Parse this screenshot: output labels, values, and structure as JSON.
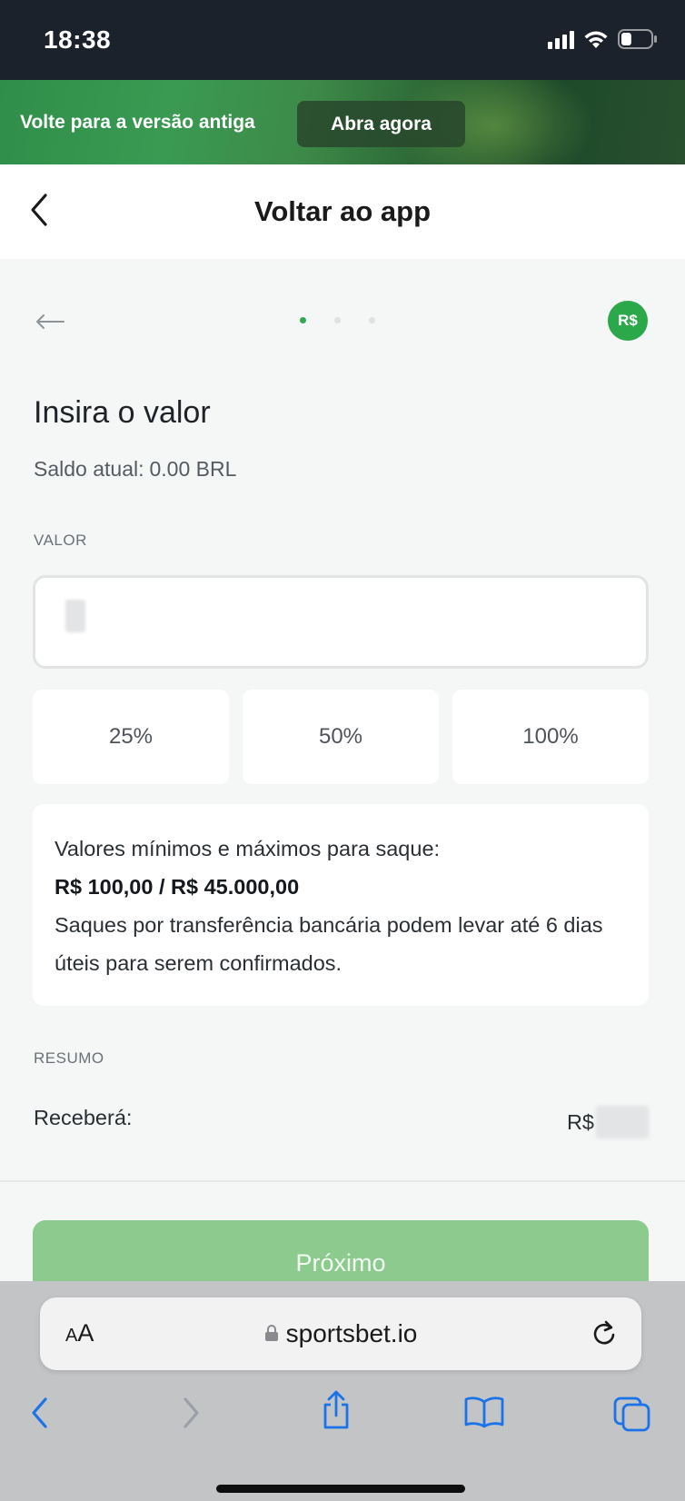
{
  "status_bar": {
    "time": "18:38",
    "battery_level": 0.35
  },
  "banner": {
    "text": "Volte para a versão antiga",
    "button_label": "Abra agora"
  },
  "header": {
    "title": "Voltar ao app"
  },
  "stepper": {
    "total_steps": 3,
    "current_step": 1
  },
  "currency_badge": "R$",
  "page": {
    "title": "Insira o valor",
    "balance_label": "Saldo atual:",
    "balance_value": "0.00 BRL"
  },
  "amount_field": {
    "label": "VALOR",
    "value": "",
    "placeholder": ""
  },
  "percent_buttons": [
    "25%",
    "50%",
    "100%"
  ],
  "info": {
    "line1": "Valores mínimos e máximos para saque:",
    "limits": "R$ 100,00 / R$ 45.000,00",
    "note": "Saques por transferência bancária podem levar até 6 dias úteis para serem confirmados."
  },
  "summary": {
    "label": "RESUMO",
    "receive_label": "Receberá:",
    "receive_currency": "R$"
  },
  "next_button": "Próximo",
  "browser": {
    "aa_small": "A",
    "aa_large": "A",
    "url": "sportsbet.io"
  },
  "colors": {
    "accent_green": "#2aa84a",
    "next_button_disabled": "#8ccb8d",
    "status_bar": "#1b222b",
    "ios_blue": "#1a73e8"
  }
}
